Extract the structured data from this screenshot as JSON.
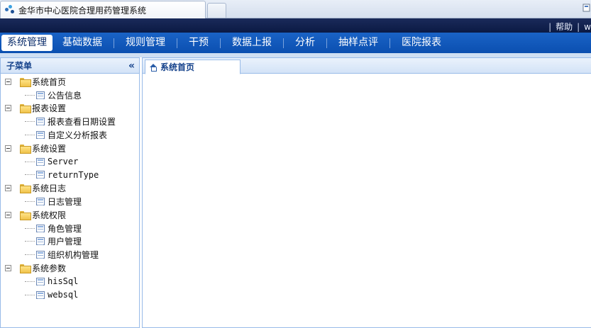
{
  "browser": {
    "tab_title": "金华市中心医院合理用药管理系统"
  },
  "topbar": {
    "help_label": "帮助",
    "trailing_text": "w"
  },
  "mainnav": {
    "items": [
      "系统管理",
      "基础数据",
      "规则管理",
      "干预",
      "数据上报",
      "分析",
      "抽样点评",
      "医院报表"
    ],
    "active_index": 0
  },
  "sidebar": {
    "title": "子菜单",
    "collapse_glyph": "«",
    "groups": [
      {
        "label": "系统首页",
        "children": [
          "公告信息"
        ]
      },
      {
        "label": "报表设置",
        "children": [
          "报表查看日期设置",
          "自定义分析报表"
        ]
      },
      {
        "label": "系统设置",
        "children": [
          "Server",
          "returnType"
        ]
      },
      {
        "label": "系统日志",
        "children": [
          "日志管理"
        ]
      },
      {
        "label": "系统权限",
        "children": [
          "角色管理",
          "用户管理",
          "组织机构管理"
        ]
      },
      {
        "label": "系统参数",
        "children": [
          "hisSql",
          "websql"
        ]
      }
    ]
  },
  "content": {
    "tab_label": "系统首页"
  },
  "colors": {
    "nav_blue": "#0b4fb0",
    "header_dark": "#0b1a44",
    "panel_border": "#99bbe8"
  }
}
